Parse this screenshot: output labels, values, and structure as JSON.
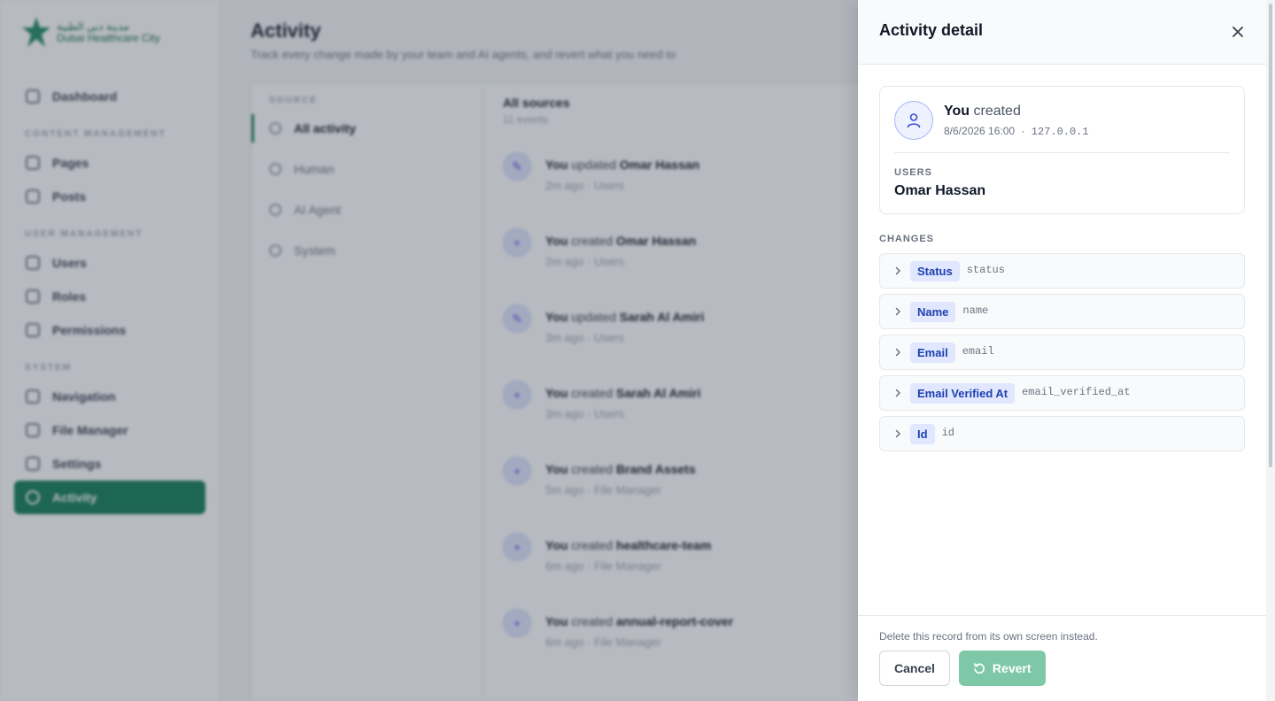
{
  "background": {
    "logo": {
      "arabic": "مدينة دبي الطبية",
      "english": "Dubai Healthcare City"
    },
    "nav": {
      "dashboard": "Dashboard",
      "section_content": "CONTENT MANAGEMENT",
      "pages": "Pages",
      "posts": "Posts",
      "section_users": "USER MANAGEMENT",
      "users": "Users",
      "roles": "Roles",
      "permissions": "Permissions",
      "section_system": "SYSTEM",
      "navigation": "Navigation",
      "file_manager": "File Manager",
      "settings": "Settings",
      "activity": "Activity"
    },
    "page": {
      "title": "Activity",
      "subtitle": "Track every change made by your team and AI agents, and revert what you need to"
    },
    "sources": {
      "heading": "SOURCE",
      "items": [
        "All activity",
        "Human",
        "AI Agent",
        "System"
      ]
    },
    "feed": {
      "title": "All sources",
      "count": "11 events",
      "items": [
        {
          "actor": "You",
          "verb": "updated",
          "target": "Omar Hassan",
          "time": "2m ago",
          "module": "Users",
          "icon": "✎"
        },
        {
          "actor": "You",
          "verb": "created",
          "target": "Omar Hassan",
          "time": "2m ago",
          "module": "Users",
          "icon": "+"
        },
        {
          "actor": "You",
          "verb": "updated",
          "target": "Sarah Al Amiri",
          "time": "3m ago",
          "module": "Users",
          "icon": "✎"
        },
        {
          "actor": "You",
          "verb": "created",
          "target": "Sarah Al Amiri",
          "time": "3m ago",
          "module": "Users",
          "icon": "+"
        },
        {
          "actor": "You",
          "verb": "created",
          "target": "Brand Assets",
          "time": "5m ago",
          "module": "File Manager",
          "icon": "+"
        },
        {
          "actor": "You",
          "verb": "created",
          "target": "healthcare-team",
          "time": "6m ago",
          "module": "File Manager",
          "icon": "+"
        },
        {
          "actor": "You",
          "verb": "created",
          "target": "annual-report-cover",
          "time": "6m ago",
          "module": "File Manager",
          "icon": "+"
        }
      ],
      "separator": "·"
    }
  },
  "drawer": {
    "title": "Activity detail",
    "actor": {
      "who": "You",
      "verb": "created",
      "timestamp": "8/6/2026 16:00",
      "separator": "·",
      "ip": "127.0.0.1"
    },
    "record": {
      "label": "USERS",
      "name": "Omar Hassan"
    },
    "changes_label": "CHANGES",
    "changes": [
      {
        "label": "Status",
        "key": "status"
      },
      {
        "label": "Name",
        "key": "name"
      },
      {
        "label": "Email",
        "key": "email"
      },
      {
        "label": "Email Verified At",
        "key": "email_verified_at"
      },
      {
        "label": "Id",
        "key": "id"
      }
    ],
    "footer": {
      "note": "Delete this record from its own screen instead.",
      "cancel": "Cancel",
      "revert": "Revert"
    }
  },
  "colors": {
    "brand": "#0f7a56",
    "revert_button": "#7ec8a8",
    "field_chip_bg": "#e0e7ff",
    "field_chip_text": "#1e40af"
  }
}
